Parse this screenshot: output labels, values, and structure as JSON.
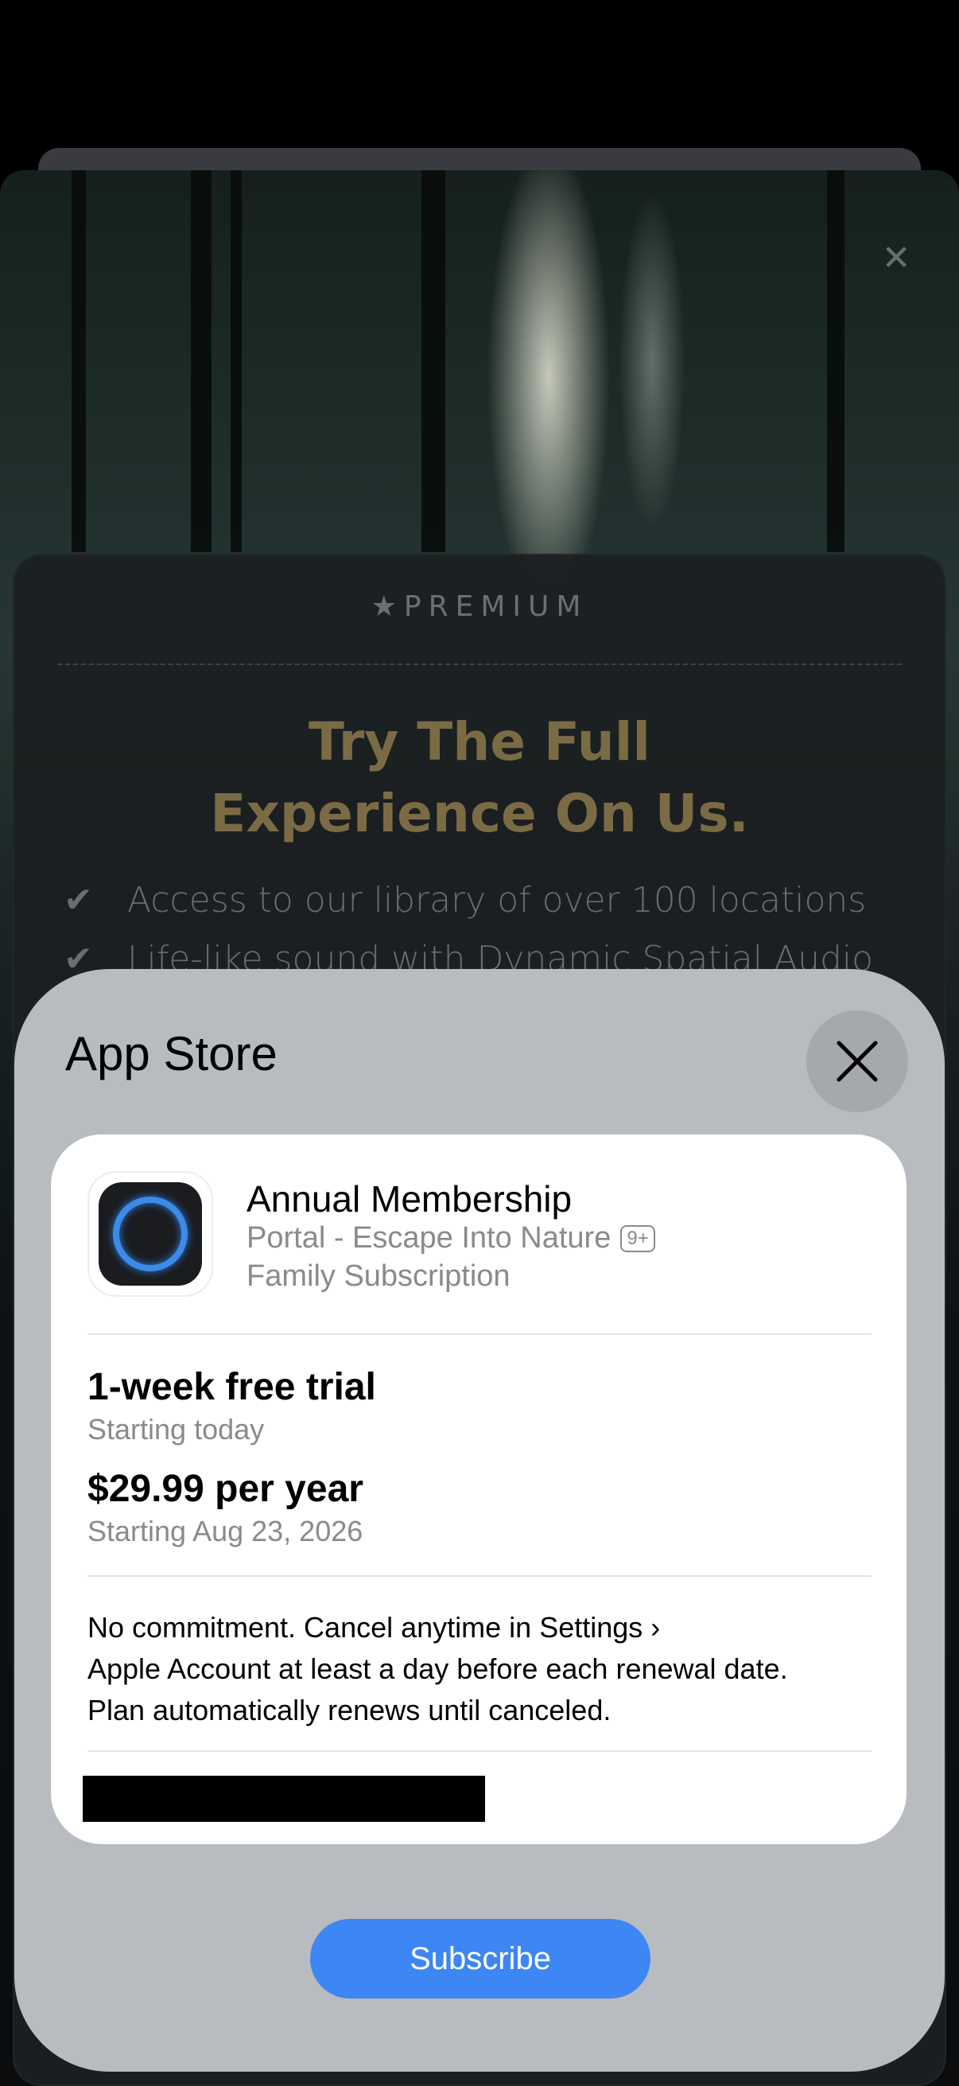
{
  "background_app": {
    "premium_label": "PREMIUM",
    "headline_line1": "Try The Full",
    "headline_line2": "Experience On Us.",
    "features": [
      "Access to our library of over 100 locations",
      "Life-like sound with Dynamic Spatial Audio"
    ],
    "close_icon": "close-icon",
    "star_icon": "star-icon",
    "check_icon": "checkmark-icon"
  },
  "sheet": {
    "title": "App Store",
    "close_icon": "close-icon"
  },
  "product": {
    "name": "Annual Membership",
    "app_name": "Portal - Escape Into Nature",
    "age_rating": "9+",
    "subscription_type": "Family Subscription"
  },
  "offer": {
    "trial_title": "1-week free trial",
    "trial_start": "Starting today",
    "price_title": "$29.99 per year",
    "price_start": "Starting Aug 23, 2026"
  },
  "notice": {
    "line1_prefix": "No commitment. Cancel anytime in ",
    "settings_link": "Settings",
    "line2": "Apple Account at least a day before each renewal date.",
    "line3": "Plan automatically renews until canceled."
  },
  "actions": {
    "subscribe_label": "Subscribe"
  },
  "colors": {
    "accent": "#3e86f3",
    "headline_gold": "#7b6b45",
    "sheet_bg": "#b8bbbf"
  }
}
